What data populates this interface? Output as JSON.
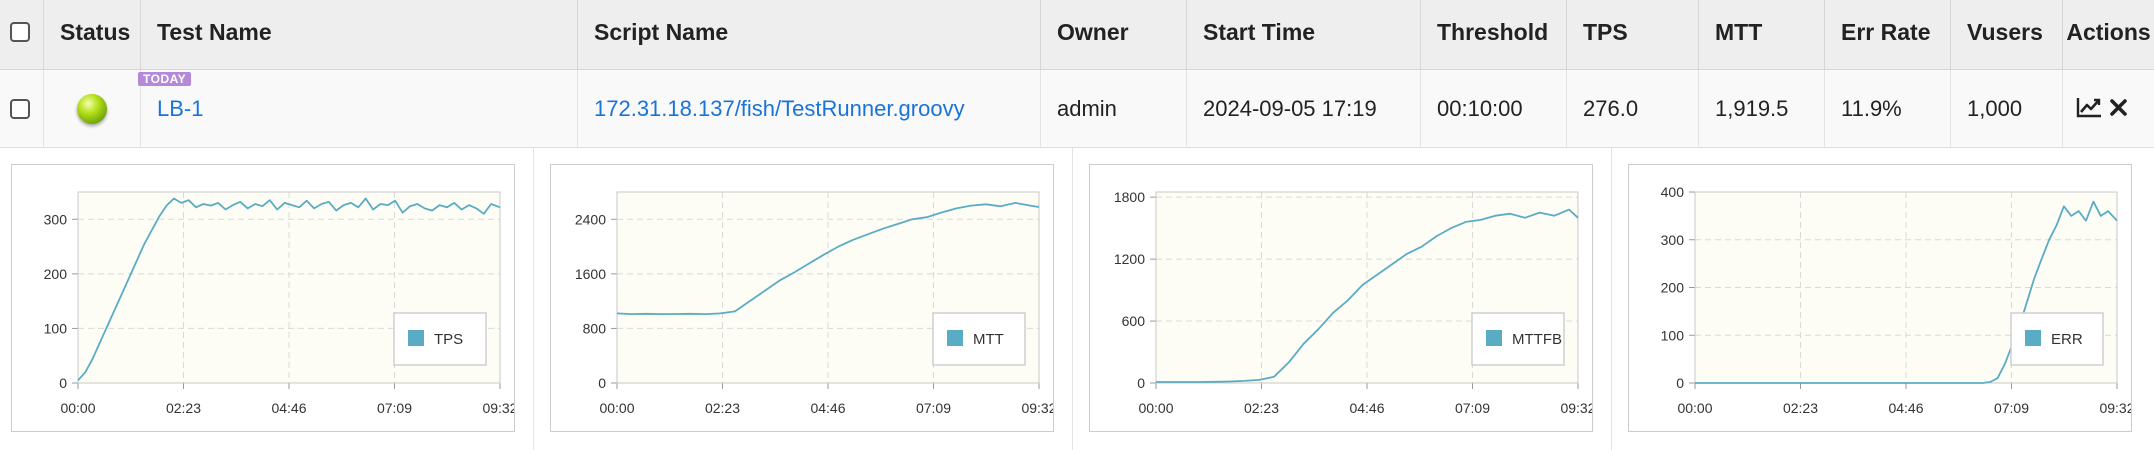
{
  "header": {
    "columns": [
      "Status",
      "Test Name",
      "Script Name",
      "Owner",
      "Start Time",
      "Threshold",
      "TPS",
      "MTT",
      "Err Rate",
      "Vusers",
      "Actions"
    ]
  },
  "row": {
    "badge": "TODAY",
    "status": "green",
    "test_name": "LB-1",
    "script_name": "172.31.18.137/fish/TestRunner.groovy",
    "owner": "admin",
    "start_time": "2024-09-05 17:19",
    "threshold": "00:10:00",
    "tps": "276.0",
    "mtt": "1,919.5",
    "err_rate": "11.9%",
    "vusers": "1,000",
    "actions": [
      "chart-icon",
      "close-icon"
    ]
  },
  "colors": {
    "line": "#5aacc4",
    "legend_swatch": "#5aacc4",
    "plot_bg": "#fdfdf6",
    "grid": "#d9d9d9",
    "link": "#1a73d9",
    "badge": "#b48ad8"
  },
  "chart_data": [
    {
      "type": "line",
      "legend": "TPS",
      "legend_position": "bottom-right",
      "grid": true,
      "xticks": [
        "00:00",
        "02:23",
        "04:46",
        "07:09",
        "09:32"
      ],
      "xlim_sec": [
        0,
        572
      ],
      "yticks": [
        0,
        100,
        200,
        300
      ],
      "ylim": [
        0,
        350
      ],
      "x_sec": [
        0,
        10,
        20,
        30,
        40,
        50,
        60,
        70,
        80,
        90,
        100,
        110,
        120,
        130,
        140,
        150,
        160,
        170,
        180,
        190,
        200,
        210,
        220,
        230,
        240,
        250,
        260,
        270,
        280,
        290,
        300,
        310,
        320,
        330,
        340,
        350,
        360,
        370,
        380,
        390,
        400,
        410,
        420,
        430,
        440,
        450,
        460,
        470,
        480,
        490,
        500,
        510,
        520,
        530,
        540,
        550,
        560,
        572
      ],
      "values": [
        5,
        20,
        45,
        75,
        105,
        135,
        165,
        195,
        225,
        255,
        280,
        305,
        325,
        338,
        330,
        335,
        322,
        328,
        325,
        330,
        318,
        326,
        332,
        320,
        328,
        324,
        335,
        318,
        330,
        326,
        322,
        334,
        320,
        328,
        332,
        316,
        326,
        330,
        322,
        338,
        318,
        328,
        326,
        334,
        312,
        324,
        328,
        320,
        316,
        326,
        322,
        330,
        318,
        326,
        320,
        310,
        328,
        322
      ]
    },
    {
      "type": "line",
      "legend": "MTT",
      "legend_position": "bottom-right",
      "grid": true,
      "xticks": [
        "00:00",
        "02:23",
        "04:46",
        "07:09",
        "09:32"
      ],
      "xlim_sec": [
        0,
        572
      ],
      "yticks": [
        0,
        800,
        1600,
        2400
      ],
      "ylim": [
        0,
        2800
      ],
      "x_sec": [
        0,
        20,
        40,
        60,
        80,
        100,
        120,
        140,
        160,
        180,
        200,
        220,
        240,
        260,
        280,
        300,
        320,
        340,
        360,
        380,
        400,
        420,
        440,
        460,
        480,
        500,
        520,
        540,
        560,
        572
      ],
      "values": [
        1020,
        1010,
        1015,
        1010,
        1012,
        1015,
        1010,
        1020,
        1050,
        1200,
        1350,
        1500,
        1620,
        1750,
        1880,
        2000,
        2100,
        2180,
        2260,
        2330,
        2400,
        2430,
        2500,
        2560,
        2600,
        2620,
        2590,
        2640,
        2600,
        2580
      ]
    },
    {
      "type": "line",
      "legend": "MTTFB",
      "legend_position": "bottom-right",
      "grid": true,
      "xticks": [
        "00:00",
        "02:23",
        "04:46",
        "07:09",
        "09:32"
      ],
      "xlim_sec": [
        0,
        572
      ],
      "yticks": [
        0,
        600,
        1200,
        1800
      ],
      "ylim": [
        0,
        1850
      ],
      "x_sec": [
        0,
        20,
        40,
        60,
        80,
        100,
        120,
        140,
        160,
        180,
        200,
        220,
        240,
        260,
        280,
        300,
        320,
        340,
        360,
        380,
        400,
        420,
        440,
        460,
        480,
        500,
        520,
        540,
        560,
        572
      ],
      "values": [
        10,
        10,
        10,
        10,
        12,
        15,
        20,
        30,
        60,
        200,
        380,
        520,
        680,
        800,
        950,
        1050,
        1150,
        1250,
        1320,
        1420,
        1500,
        1560,
        1580,
        1620,
        1640,
        1600,
        1650,
        1620,
        1680,
        1600
      ]
    },
    {
      "type": "line",
      "legend": "ERR",
      "legend_position": "bottom-right",
      "grid": true,
      "xticks": [
        "00:00",
        "02:23",
        "04:46",
        "07:09",
        "09:32"
      ],
      "xlim_sec": [
        0,
        572
      ],
      "yticks": [
        0,
        100,
        200,
        300,
        400
      ],
      "ylim": [
        0,
        400
      ],
      "x_sec": [
        0,
        50,
        100,
        150,
        200,
        250,
        300,
        350,
        390,
        400,
        410,
        420,
        430,
        440,
        450,
        460,
        470,
        480,
        490,
        500,
        510,
        520,
        530,
        540,
        550,
        560,
        572
      ],
      "values": [
        0,
        0,
        0,
        0,
        0,
        0,
        0,
        0,
        0,
        2,
        10,
        40,
        80,
        120,
        170,
        220,
        260,
        300,
        330,
        370,
        350,
        360,
        340,
        380,
        350,
        360,
        340
      ]
    }
  ]
}
